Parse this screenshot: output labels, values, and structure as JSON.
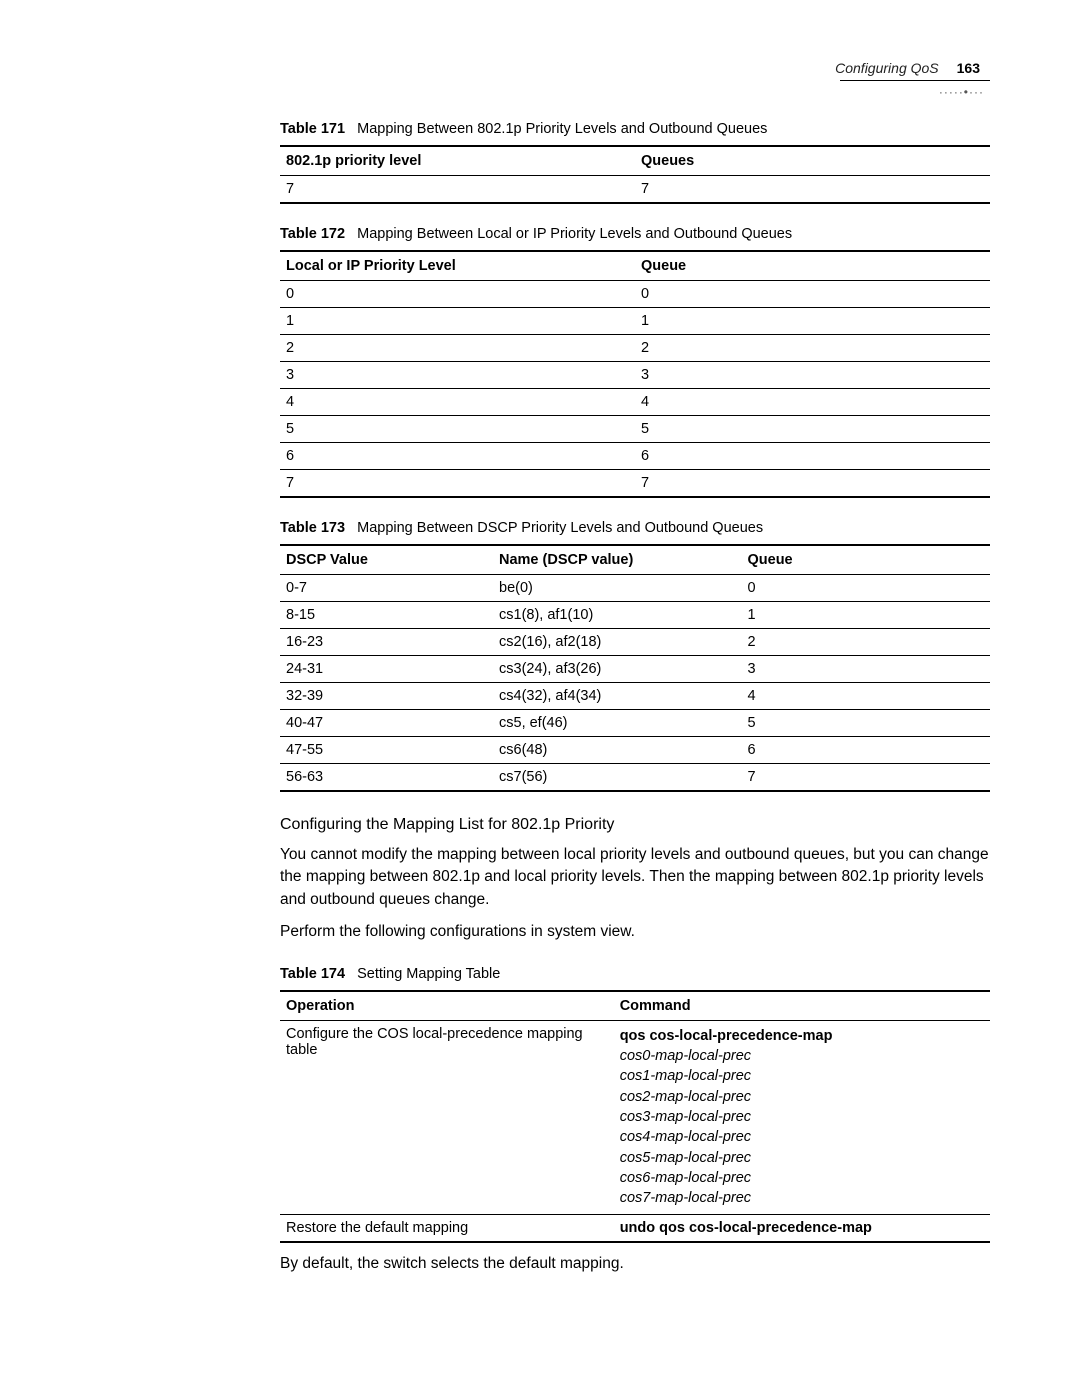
{
  "header": {
    "section": "Configuring QoS",
    "page": "163"
  },
  "table171": {
    "caption_label": "Table 171",
    "caption_text": "Mapping Between 802.1p Priority Levels and Outbound Queues",
    "headers": [
      "802.1p priority level",
      "Queues"
    ],
    "rows": [
      [
        "7",
        "7"
      ]
    ]
  },
  "table172": {
    "caption_label": "Table 172",
    "caption_text": "Mapping Between Local or IP Priority Levels and Outbound Queues",
    "headers": [
      "Local or IP Priority Level",
      "Queue"
    ],
    "rows": [
      [
        "0",
        "0"
      ],
      [
        "1",
        "1"
      ],
      [
        "2",
        "2"
      ],
      [
        "3",
        "3"
      ],
      [
        "4",
        "4"
      ],
      [
        "5",
        "5"
      ],
      [
        "6",
        "6"
      ],
      [
        "7",
        "7"
      ]
    ]
  },
  "table173": {
    "caption_label": "Table 173",
    "caption_text": "Mapping Between DSCP Priority Levels and Outbound Queues",
    "headers": [
      "DSCP Value",
      "Name (DSCP value)",
      "Queue"
    ],
    "rows": [
      [
        "0-7",
        "be(0)",
        "0"
      ],
      [
        "8-15",
        "cs1(8), af1(10)",
        "1"
      ],
      [
        "16-23",
        "cs2(16), af2(18)",
        "2"
      ],
      [
        "24-31",
        "cs3(24), af3(26)",
        "3"
      ],
      [
        "32-39",
        "cs4(32), af4(34)",
        "4"
      ],
      [
        "40-47",
        "cs5, ef(46)",
        "5"
      ],
      [
        "47-55",
        "cs6(48)",
        "6"
      ],
      [
        "56-63",
        "cs7(56)",
        "7"
      ]
    ]
  },
  "section2": {
    "heading": "Configuring the Mapping List for 802.1p Priority",
    "para1": "You cannot modify the mapping between local priority levels and outbound queues, but you can change the mapping between 802.1p and local priority levels. Then the mapping between 802.1p priority levels and outbound queues change.",
    "para2": "Perform the following configurations in system view."
  },
  "table174": {
    "caption_label": "Table 174",
    "caption_text": "Setting Mapping Table",
    "headers": [
      "Operation",
      "Command"
    ],
    "rows": [
      {
        "op": "Configure the COS local-precedence mapping table",
        "cmd_bold": "qos cos-local-precedence-map",
        "cmd_args": [
          "cos0-map-local-prec",
          "cos1-map-local-prec",
          "cos2-map-local-prec",
          "cos3-map-local-prec",
          "cos4-map-local-prec",
          "cos5-map-local-prec",
          "cos6-map-local-prec",
          "cos7-map-local-prec"
        ]
      },
      {
        "op": "Restore the default mapping",
        "cmd_bold": "undo qos cos-local-precedence-map",
        "cmd_args": []
      }
    ]
  },
  "footer_text": "By default, the switch selects the default mapping."
}
